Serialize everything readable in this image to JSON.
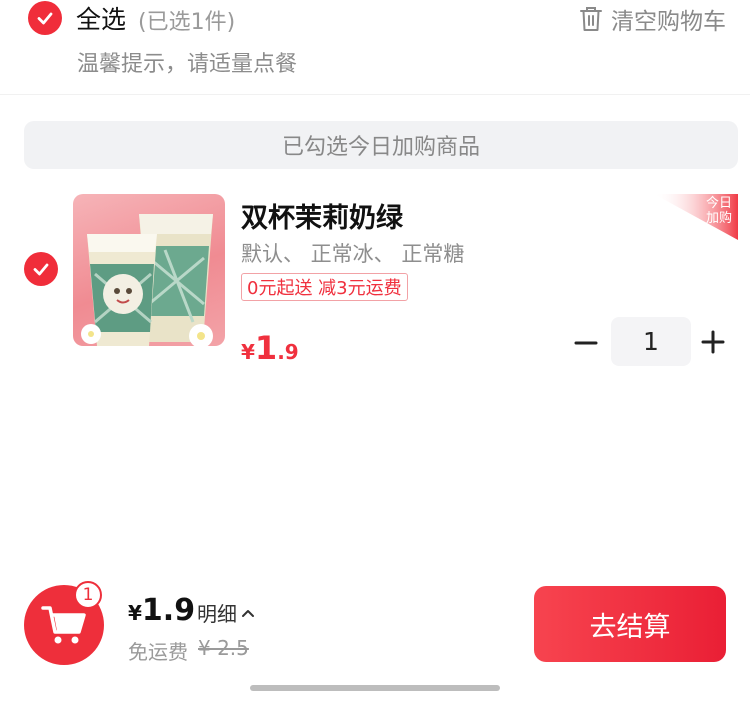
{
  "header": {
    "select_all_label": "全选",
    "selected_count": "(已选1件)",
    "clear_cart_label": "清空购物车",
    "tip": "温馨提示，请适量点餐"
  },
  "banner": {
    "text": "已勾选今日加购商品"
  },
  "item": {
    "title": "双杯茉莉奶绿",
    "spec": "默认、 正常冰、 正常糖",
    "promo": "0元起送 减3元运费",
    "price_symbol": "¥",
    "price_int": "1",
    "price_dec": ".9",
    "corner_tag_line1": "今日",
    "corner_tag_line2": "加购",
    "quantity": "1"
  },
  "footer": {
    "cart_badge": "1",
    "total_symbol": "¥",
    "total": "1.9",
    "detail_label": "明细",
    "free_shipping_label": "免运费",
    "original_shipping": "¥ 2.5",
    "checkout_label": "去结算"
  },
  "colors": {
    "accent": "#f02d3a",
    "banner_bg": "#f1f2f4",
    "qty_bg": "#f4f4f6"
  },
  "icons": [
    "check-icon",
    "trash-icon",
    "minus-icon",
    "plus-icon",
    "cart-icon",
    "chevron-up-icon"
  ]
}
